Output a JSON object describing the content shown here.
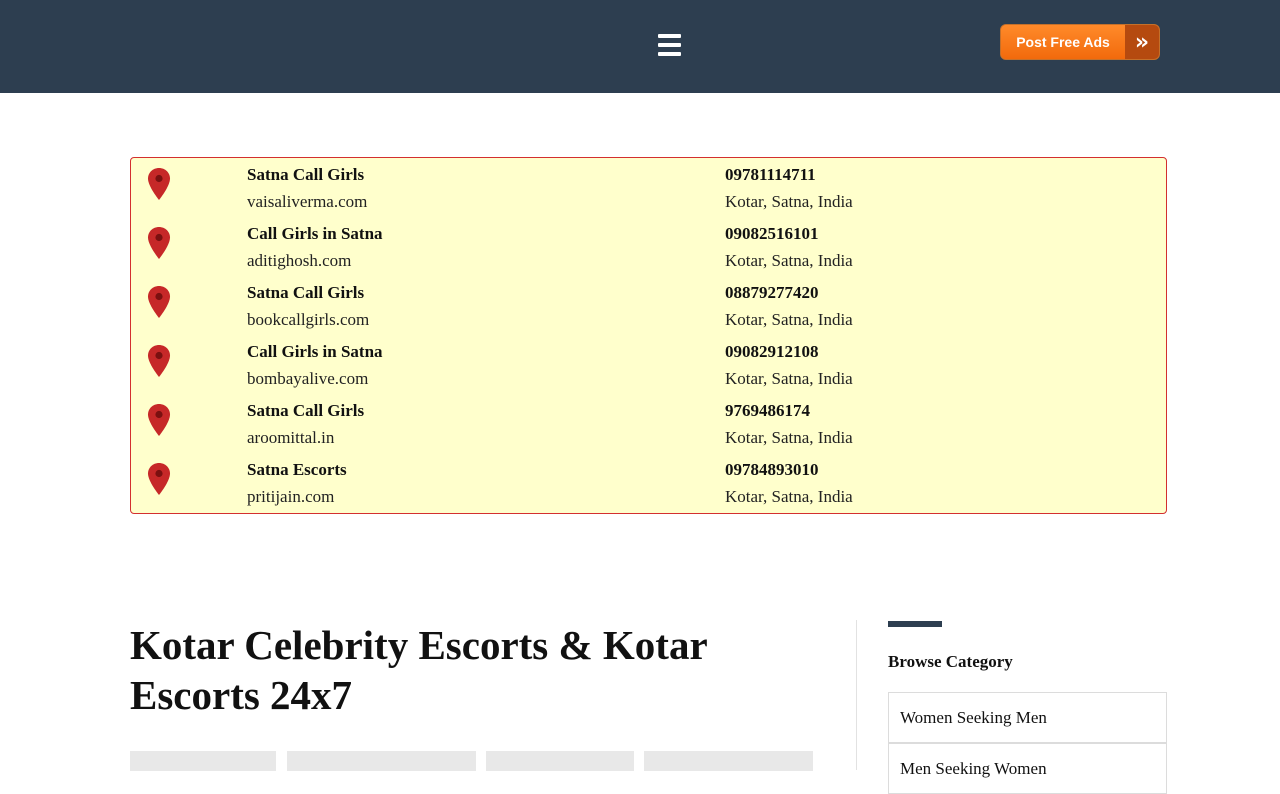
{
  "header": {
    "menu_icon": "hamburger-icon",
    "post_button_label": "Post Free Ads",
    "post_button_icon": "double-chevron-right-icon",
    "background_color": "#2d3e50",
    "button_color": "#ff7a1a"
  },
  "listings": [
    {
      "title": "Satna Call Girls",
      "site": "vaisaliverma.com",
      "phone": "09781114711",
      "location": "Kotar, Satna, India"
    },
    {
      "title": "Call Girls in Satna",
      "site": "aditighosh.com",
      "phone": "09082516101",
      "location": "Kotar, Satna, India"
    },
    {
      "title": "Satna Call Girls",
      "site": "bookcallgirls.com",
      "phone": "08879277420",
      "location": "Kotar, Satna, India"
    },
    {
      "title": "Call Girls in Satna",
      "site": "bombayalive.com",
      "phone": "09082912108",
      "location": "Kotar, Satna, India"
    },
    {
      "title": "Satna Call Girls",
      "site": "aroomittal.in",
      "phone": "9769486174",
      "location": "Kotar, Satna, India"
    },
    {
      "title": "Satna Escorts",
      "site": "pritijain.com",
      "phone": "09784893010",
      "location": "Kotar, Satna, India"
    }
  ],
  "listing_pin_icon": "map-pin-icon",
  "listing_box_colors": {
    "background": "#ffffcc",
    "border": "#d32f2f"
  },
  "main": {
    "title": "Kotar Celebrity Escorts & Kotar Escorts 24x7"
  },
  "sidebar": {
    "heading": "Browse Category",
    "categories": [
      "Women Seeking Men",
      "Men Seeking Women"
    ]
  }
}
